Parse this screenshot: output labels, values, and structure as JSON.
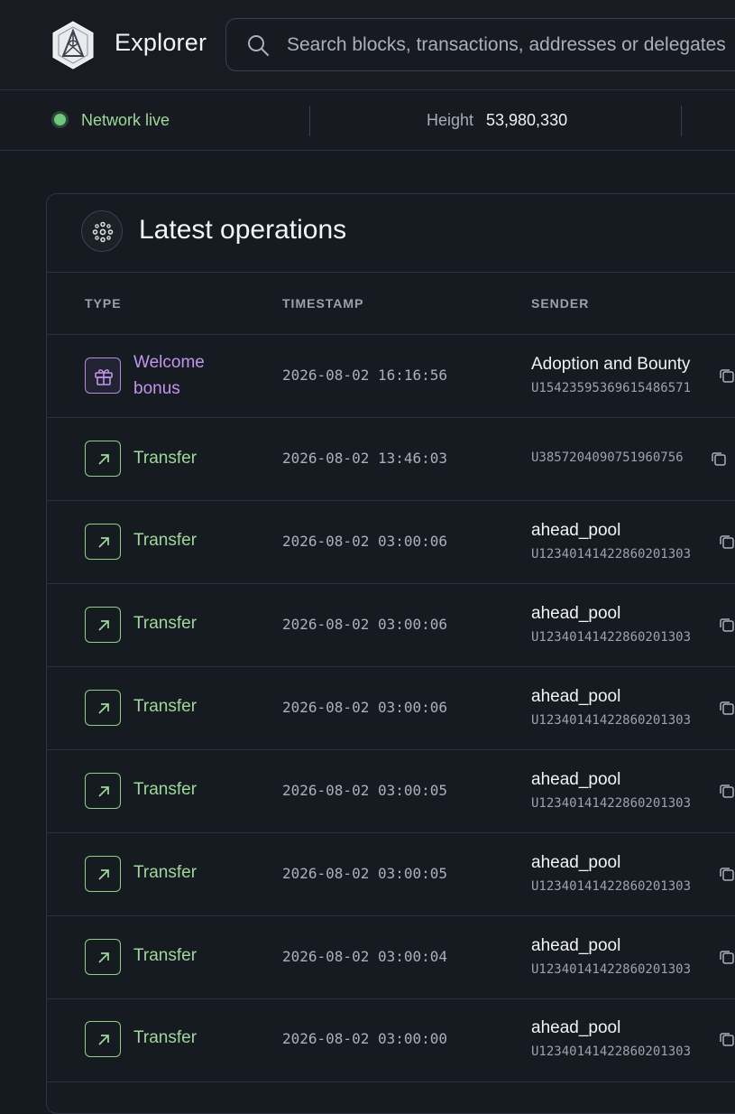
{
  "header": {
    "title": "Explorer",
    "search_placeholder": "Search blocks, transactions, addresses or delegates"
  },
  "status": {
    "network": "Network live",
    "height_label": "Height",
    "height_value": "53,980,330",
    "live_color": "#6fc77b"
  },
  "card": {
    "title": "Latest operations",
    "columns": [
      "TYPE",
      "TIMESTAMP",
      "SENDER"
    ]
  },
  "operations": [
    {
      "type": "Welcome bonus",
      "type_line1": "Welcome",
      "type_line2": "bonus",
      "icon": "gift-icon",
      "timestamp": "2026-08-02 16:16:56",
      "sender_name": "Adoption and Bounty",
      "sender_id": "U15423595369615486571"
    },
    {
      "type": "Transfer",
      "icon": "arrow-up-right-icon",
      "timestamp": "2026-08-02 13:46:03",
      "sender_name": "",
      "sender_id": "U3857204090751960756"
    },
    {
      "type": "Transfer",
      "icon": "arrow-up-right-icon",
      "timestamp": "2026-08-02 03:00:06",
      "sender_name": "ahead_pool",
      "sender_id": "U12340141422860201303"
    },
    {
      "type": "Transfer",
      "icon": "arrow-up-right-icon",
      "timestamp": "2026-08-02 03:00:06",
      "sender_name": "ahead_pool",
      "sender_id": "U12340141422860201303"
    },
    {
      "type": "Transfer",
      "icon": "arrow-up-right-icon",
      "timestamp": "2026-08-02 03:00:06",
      "sender_name": "ahead_pool",
      "sender_id": "U12340141422860201303"
    },
    {
      "type": "Transfer",
      "icon": "arrow-up-right-icon",
      "timestamp": "2026-08-02 03:00:05",
      "sender_name": "ahead_pool",
      "sender_id": "U12340141422860201303"
    },
    {
      "type": "Transfer",
      "icon": "arrow-up-right-icon",
      "timestamp": "2026-08-02 03:00:05",
      "sender_name": "ahead_pool",
      "sender_id": "U12340141422860201303"
    },
    {
      "type": "Transfer",
      "icon": "arrow-up-right-icon",
      "timestamp": "2026-08-02 03:00:04",
      "sender_name": "ahead_pool",
      "sender_id": "U12340141422860201303"
    },
    {
      "type": "Transfer",
      "icon": "arrow-up-right-icon",
      "timestamp": "2026-08-02 03:00:00",
      "sender_name": "ahead_pool",
      "sender_id": "U12340141422860201303"
    }
  ]
}
